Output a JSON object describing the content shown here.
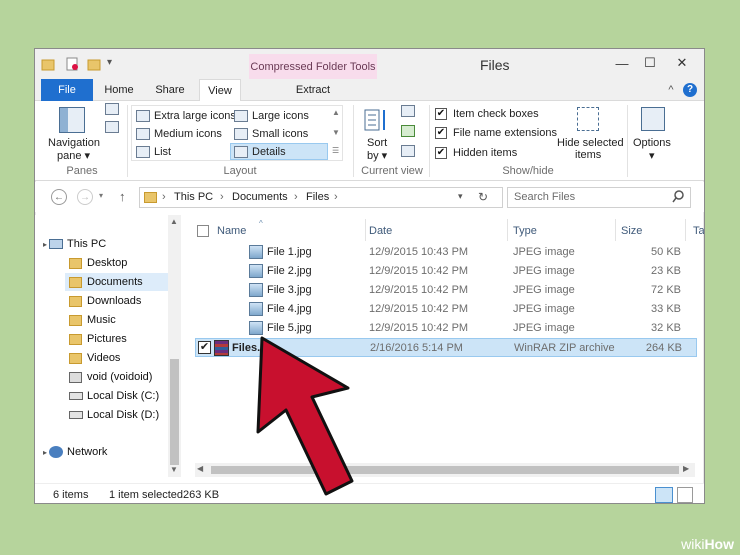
{
  "window": {
    "title": "Files",
    "context_tab": "Compressed Folder Tools",
    "controls": {
      "minimize": "—",
      "maximize": "☐",
      "close": "✕"
    }
  },
  "ribbon_tabs": [
    {
      "label": "File"
    },
    {
      "label": "Home"
    },
    {
      "label": "Share"
    },
    {
      "label": "View"
    },
    {
      "label": "Extract"
    }
  ],
  "ribbon": {
    "panes": {
      "navigation_pane": "Navigation",
      "navigation_pane_sub": "pane ▾",
      "group_label": "Panes"
    },
    "layout": {
      "items": [
        "Extra large icons",
        "Large icons",
        "Medium icons",
        "Small icons",
        "List",
        "Details"
      ],
      "group_label": "Layout"
    },
    "current_view": {
      "sort_by": "Sort",
      "sort_by_sub": "by ▾",
      "group_label": "Current view"
    },
    "show_hide": {
      "checkboxes": [
        {
          "label": "Item check boxes",
          "checked": true
        },
        {
          "label": "File name extensions",
          "checked": true
        },
        {
          "label": "Hidden items",
          "checked": true
        }
      ],
      "hide_selected": "Hide selected",
      "hide_selected_sub": "items",
      "group_label": "Show/hide"
    },
    "options": {
      "label": "Options",
      "sub": "▾"
    },
    "help": "?",
    "collapse": "^"
  },
  "address": {
    "breadcrumb": [
      "This PC",
      "Documents",
      "Files"
    ],
    "separator": "›",
    "search_placeholder": "Search Files"
  },
  "nav_pane": {
    "items": [
      {
        "label": "This PC",
        "icon": "computer-icon"
      },
      {
        "label": "Desktop",
        "icon": "folder-icon"
      },
      {
        "label": "Documents",
        "icon": "folder-icon",
        "selected": true
      },
      {
        "label": "Downloads",
        "icon": "folder-icon"
      },
      {
        "label": "Music",
        "icon": "folder-icon"
      },
      {
        "label": "Pictures",
        "icon": "folder-icon"
      },
      {
        "label": "Videos",
        "icon": "folder-icon"
      },
      {
        "label": "void (voidoid)",
        "icon": "network-drive-icon"
      },
      {
        "label": "Local Disk (C:)",
        "icon": "drive-icon"
      },
      {
        "label": "Local Disk (D:)",
        "icon": "drive-icon"
      },
      {
        "label": "Network",
        "icon": "network-icon"
      }
    ]
  },
  "file_list": {
    "columns": [
      "Name",
      "Date",
      "Type",
      "Size",
      "Tags"
    ],
    "rows": [
      {
        "name": "File 1.jpg",
        "date": "12/9/2015 10:43 PM",
        "type": "JPEG image",
        "size": "50 KB",
        "icon": "image-file-icon",
        "selected": false
      },
      {
        "name": "File 2.jpg",
        "date": "12/9/2015 10:42 PM",
        "type": "JPEG image",
        "size": "23 KB",
        "icon": "image-file-icon",
        "selected": false
      },
      {
        "name": "File 3.jpg",
        "date": "12/9/2015 10:42 PM",
        "type": "JPEG image",
        "size": "72 KB",
        "icon": "image-file-icon",
        "selected": false
      },
      {
        "name": "File 4.jpg",
        "date": "12/9/2015 10:42 PM",
        "type": "JPEG image",
        "size": "33 KB",
        "icon": "image-file-icon",
        "selected": false
      },
      {
        "name": "File 5.jpg",
        "date": "12/9/2015 10:42 PM",
        "type": "JPEG image",
        "size": "32 KB",
        "icon": "image-file-icon",
        "selected": false
      },
      {
        "name": "Files.zip",
        "date": "2/16/2016 5:14 PM",
        "type": "WinRAR ZIP archive",
        "size": "264 KB",
        "icon": "winrar-archive-icon",
        "selected": true
      }
    ]
  },
  "status": {
    "items_count": "6 items",
    "selection": "1 item selected",
    "selection_size": "263 KB"
  },
  "watermark": {
    "prefix": "wiki",
    "suffix": "How"
  },
  "colors": {
    "background": "#b6d49c",
    "file_tab": "#1f6fcf",
    "context_tab": "#f8dcec",
    "selection": "#cce4f7",
    "arrow": "#c8102e"
  }
}
